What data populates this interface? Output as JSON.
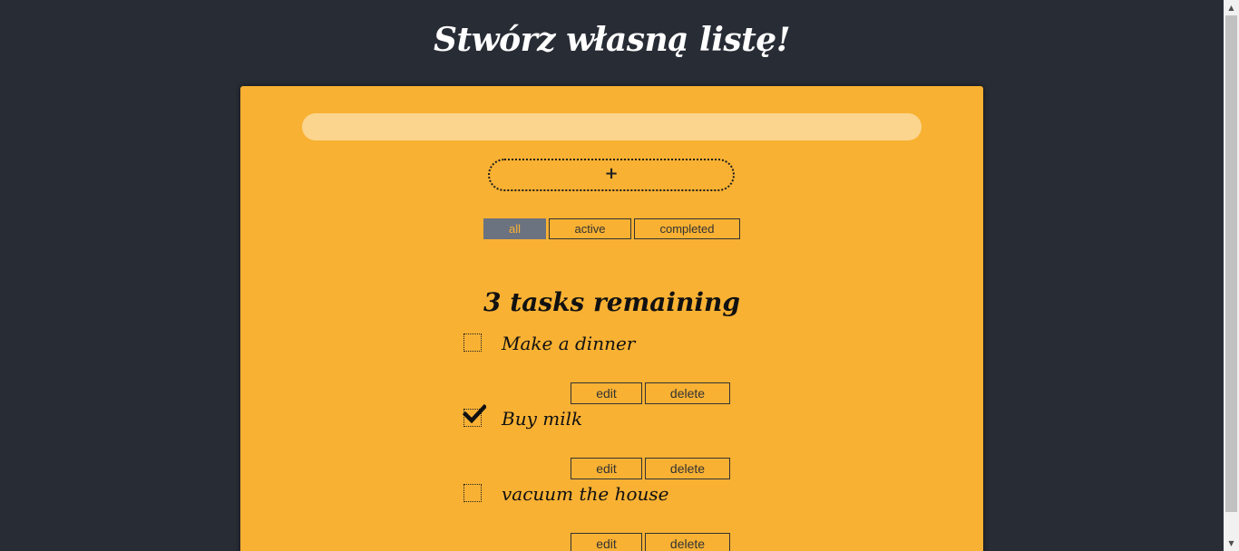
{
  "header": {
    "title": "Stwórz własną listę!"
  },
  "form": {
    "input_value": "",
    "add_label": "+"
  },
  "filters": [
    {
      "label": "all",
      "selected": true
    },
    {
      "label": "active",
      "selected": false
    },
    {
      "label": "completed",
      "selected": false
    }
  ],
  "status": {
    "remaining_text": "3 tasks remaining"
  },
  "todos": [
    {
      "label": "Make a dinner",
      "completed": false,
      "edit_label": "edit",
      "delete_label": "delete"
    },
    {
      "label": "Buy milk",
      "completed": true,
      "edit_label": "edit",
      "delete_label": "delete"
    },
    {
      "label": "vacuum the house",
      "completed": false,
      "edit_label": "edit",
      "delete_label": "delete"
    }
  ],
  "colors": {
    "background": "#282c35",
    "card": "#f8b133",
    "input": "#fbd58e",
    "selected_filter": "#6b7280"
  },
  "icons": {
    "checkmark": "check-icon",
    "scroll_up": "scroll-up-arrow-icon",
    "scroll_down": "scroll-down-arrow-icon"
  }
}
